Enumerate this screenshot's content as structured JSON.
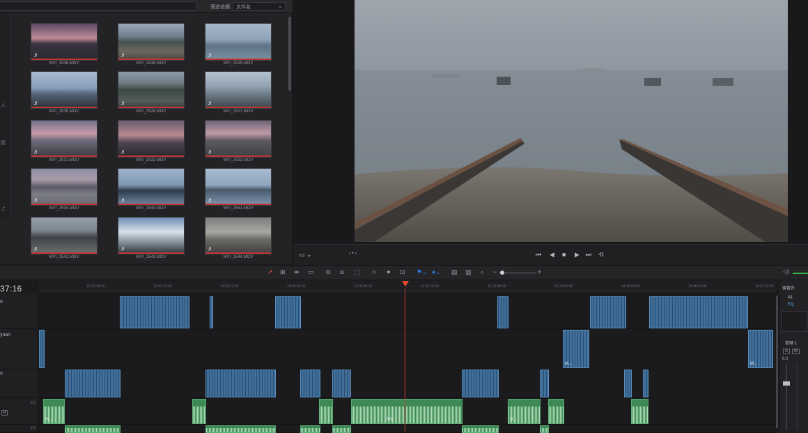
{
  "media_pool": {
    "filter_label": "筛选依据",
    "sort_value": "文件名",
    "clips": [
      {
        "name": "MVI_2536.MOV"
      },
      {
        "name": "MVI_2538.MOV"
      },
      {
        "name": "MVI_2539.MOV"
      },
      {
        "name": "MVI_2535.MOV"
      },
      {
        "name": "MVI_2526.MOV"
      },
      {
        "name": "MVI_2527.MOV"
      },
      {
        "name": "MVI_2531.MOV"
      },
      {
        "name": "MVI_2532.MOV"
      },
      {
        "name": "MVI_2533.MOV"
      },
      {
        "name": "MVI_2534.MOV"
      },
      {
        "name": "MVI_2540.MOV"
      },
      {
        "name": "MVI_2541.MOV"
      },
      {
        "name": "MVI_2542.MOV"
      },
      {
        "name": "MVI_2543.MOV"
      },
      {
        "name": "MVI_2544.MOV"
      }
    ],
    "audio_icon": "♬",
    "bin_marks": [
      "人",
      "题",
      "上"
    ]
  },
  "viewer": {
    "view_options_icon": "monitor-icon",
    "nav_dots": "‹ • ›",
    "transport": {
      "skip_start": "⏮",
      "prev": "◀",
      "stop": "■",
      "play": "▶",
      "skip_end": "⏭",
      "loop": "⟲"
    }
  },
  "toolbar": {
    "zoom_minus": "−",
    "zoom_plus": "+",
    "volume_icon": "🔈"
  },
  "timeline": {
    "timecode": "37:16",
    "ruler_ticks": [
      "15:23:28:00",
      "15:41:10:00",
      "15:50:12:00",
      "15:58:24:00",
      "16:06:36:00",
      "11:15:16:00",
      "12:23:48:00",
      "12:32:52:00",
      "14:40:24:00",
      "15:48:44:00",
      "16:57:16:00"
    ],
    "tracks": {
      "v3_label": "a",
      "v2_label": "yuan",
      "v1_label": "a",
      "a1_num": "2.0",
      "a2_num": "2.0",
      "mute_label": "M"
    },
    "clip_tag_video": "M...",
    "clip_tag_audio": "M...",
    "clip_tag_audio2": "MV..."
  },
  "mixer": {
    "title": "调音台",
    "track": "A1",
    "eq": "EQ",
    "bus": "音频 1",
    "s": "S",
    "m": "M",
    "gain": "0.0"
  },
  "colors": {
    "video_clip": "#3f6f9a",
    "audio_clip": "#3e8a55",
    "playhead": "#d23a2f",
    "accent_blue": "#2d7de0"
  }
}
